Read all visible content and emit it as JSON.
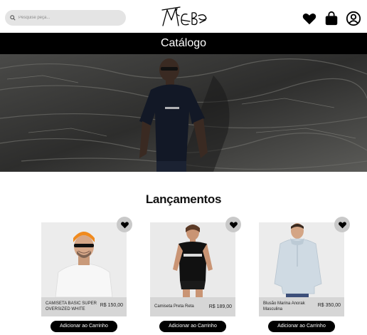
{
  "header": {
    "search_placeholder": "Pesquise peça...",
    "logo_text": "MCB"
  },
  "page_title": "Catálogo",
  "section_title": "Lançamentos",
  "products": [
    {
      "name": "CAMISETA BASIC SUPER OVERSIZED WHITE",
      "price": "R$ 150,00",
      "button": "Adicionar ao Carrinho"
    },
    {
      "name": "Camiseta Preta Reta",
      "price": "R$ 189,00",
      "button": "Adicionar ao Carrinho"
    },
    {
      "name": "Blusão Marina Anorak Masculina",
      "price": "R$ 350,00",
      "button": "Adicionar ao Carrinho"
    }
  ],
  "colors": {
    "titlebar": "#000000",
    "button": "#000000",
    "card_bg": "#e9e9e9",
    "fav_bg": "#c9c9c9"
  },
  "icons": [
    "search-icon",
    "heart-icon",
    "shopping-bag-icon",
    "user-icon",
    "favorite-heart-icon"
  ]
}
